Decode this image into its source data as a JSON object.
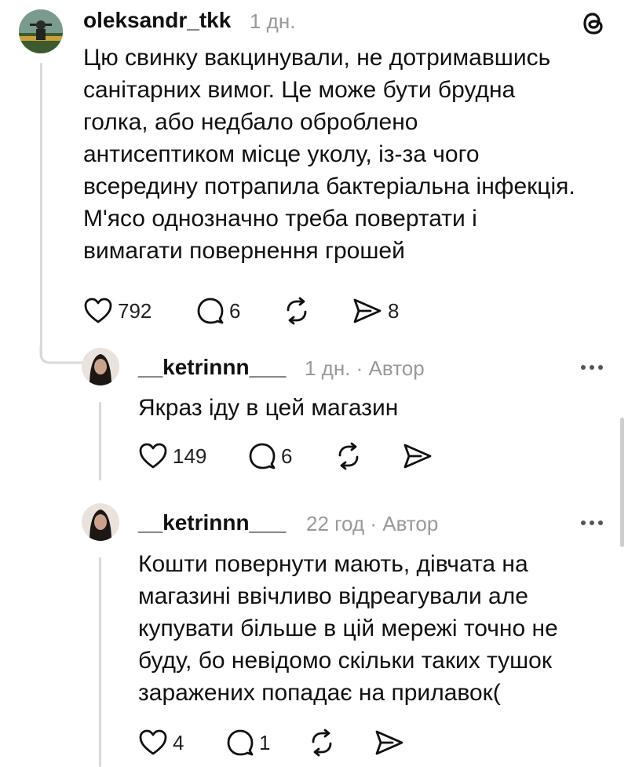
{
  "comment1": {
    "username": "oleksandr_tkk",
    "time": "1 дн.",
    "lines": [
      "Цю свинку вакцинували, не дотримавшись",
      "санітарних вимог. Це може бути брудна",
      "голка, або недбало оброблено",
      "антисептиком місце уколу, із-за чого",
      "всередину потрапила бактеріальна інфекція.",
      "М'ясо однозначно треба повертати і",
      "вимагати повернення грошей"
    ],
    "likes": "792",
    "replies": "6",
    "shares": "8"
  },
  "comment2": {
    "username": "__ketrinnn___",
    "time": "1 дн. · Автор",
    "text": "Якраз іду в цей магазин",
    "likes": "149",
    "replies": "6"
  },
  "comment3": {
    "username": "__ketrinnn___",
    "time": "22 год · Автор",
    "lines": [
      "Кошти повернути мають, дівчата на",
      "магазині ввічливо відреагували але",
      "купувати більше в цій мережі точно не",
      "буду, бо невідомо скільки таких тушок",
      "заражених попадає на прилавок("
    ],
    "likes": "4",
    "replies": "1"
  },
  "icons": {
    "app_logo": "threads-logo-icon",
    "like": "heart-icon",
    "reply": "comment-bubble-icon",
    "repost": "repost-icon",
    "share": "send-icon",
    "more": "more-dots-icon"
  }
}
